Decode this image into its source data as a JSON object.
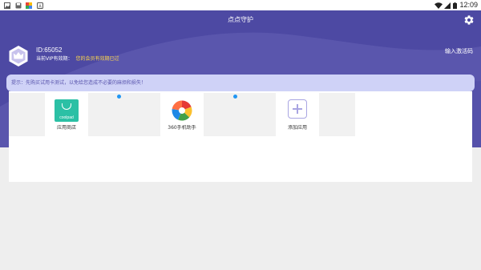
{
  "status_bar": {
    "time": "12:09",
    "left_icons": [
      "picture-icon",
      "save-icon",
      "app-icon",
      "android-icon"
    ],
    "right_icons": [
      "wifi-icon",
      "signal-icon",
      "battery-icon"
    ]
  },
  "header": {
    "title": "点点守护",
    "settings_icon": "gear-icon"
  },
  "account": {
    "id_text": "ID:65052",
    "vip_label": "当前VIP有效期：",
    "vip_value": "您的会员有效期已过",
    "activate_label": "输入激活码"
  },
  "notice": {
    "text": "提示：先购买试用卡测试，以免给您造成不必要的麻烦和损失！"
  },
  "apps": [
    {
      "label": "应用商店",
      "icon": "coolpad-app-icon",
      "icon_text": "coolpad"
    },
    {
      "label": "360手机助手",
      "icon": "360-assistant-icon"
    },
    {
      "label": "添加应用",
      "icon": "add-app-icon"
    }
  ],
  "colors": {
    "header": "#5a56ad",
    "notice_bg": "#cfd2f7",
    "vip_value": "#ffd84a",
    "badge": "#2196f3"
  }
}
